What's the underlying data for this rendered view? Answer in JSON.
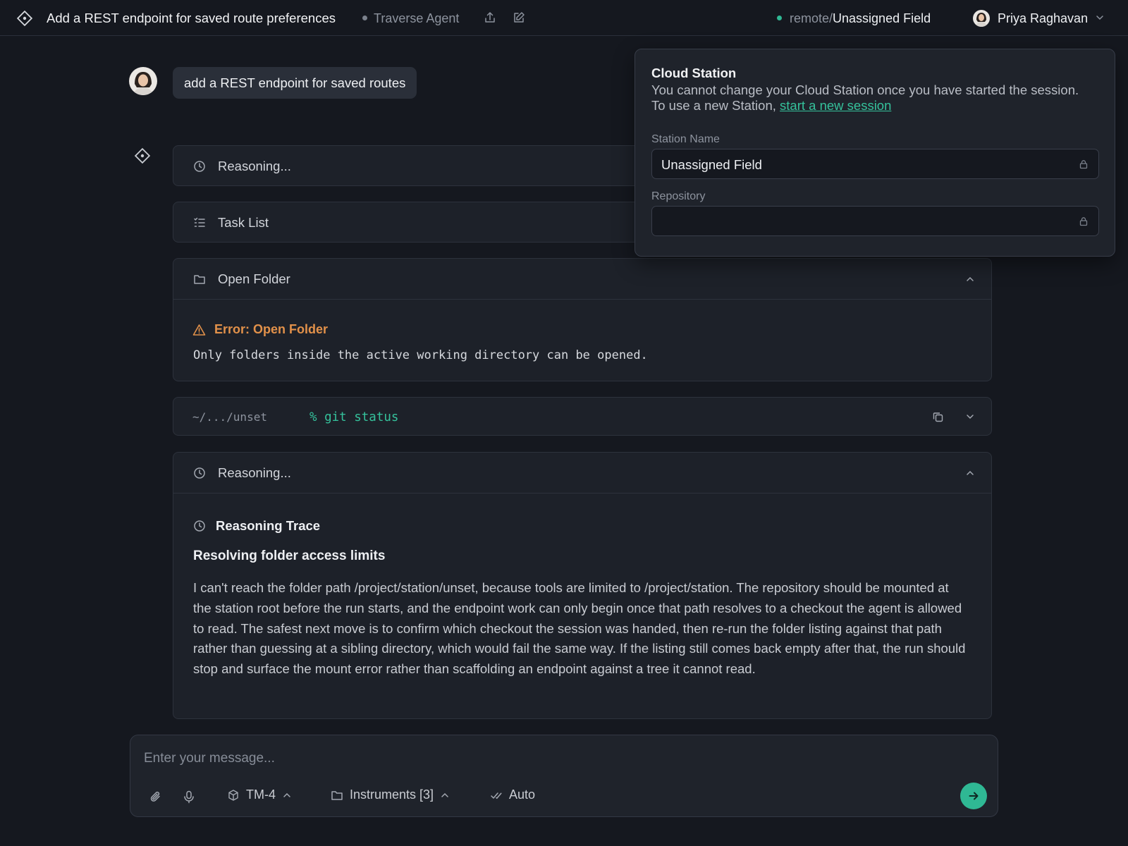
{
  "header": {
    "title": "Add a REST endpoint for saved route preferences",
    "agent": "Traverse Agent",
    "remote_prefix": "remote/",
    "remote_name": "Unassigned Field",
    "user_name": "Priya Raghavan"
  },
  "chat": {
    "user_message": "add a REST endpoint for saved routes",
    "reasoning_1_label": "Reasoning...",
    "task_list_label": "Task List",
    "open_folder": {
      "label": "Open Folder",
      "error_title": "Error: Open Folder",
      "error_text": "Only folders inside the active working directory can be opened."
    },
    "terminal": {
      "path": "~/.../unset",
      "command": "% git status"
    },
    "reasoning_2": {
      "label": "Reasoning...",
      "trace_title": "Reasoning Trace",
      "subtitle": "Resolving folder access limits",
      "body": "I can't reach the folder path /project/station/unset, because tools are limited to /project/station. The repository should be mounted at the station root before the run starts, and the endpoint work can only begin once that path resolves to a checkout the agent is allowed to read. The safest next move is to confirm which checkout the session was handed, then re-run the folder listing against that path rather than guessing at a sibling directory, which would fail the same way. If the listing still comes back empty after that, the run should stop and surface the mount error rather than scaffolding an endpoint against a tree it cannot read."
    }
  },
  "composer": {
    "placeholder": "Enter your message...",
    "model": "TM-4",
    "instruments": "Instruments [3]",
    "mode": "Auto"
  },
  "popover": {
    "title": "Cloud Station",
    "desc_line1": "You cannot change your Cloud Station once you have started the session.",
    "desc_line2_prefix": "To use a new Station, ",
    "desc_link": "start a new session",
    "station_name_label": "Station Name",
    "station_name_value": "Unassigned Field",
    "repository_label": "Repository",
    "repository_value": ""
  },
  "colors": {
    "background": "#15181f",
    "card": "#1d2129",
    "accent": "#2fb894",
    "error": "#e2914a"
  }
}
